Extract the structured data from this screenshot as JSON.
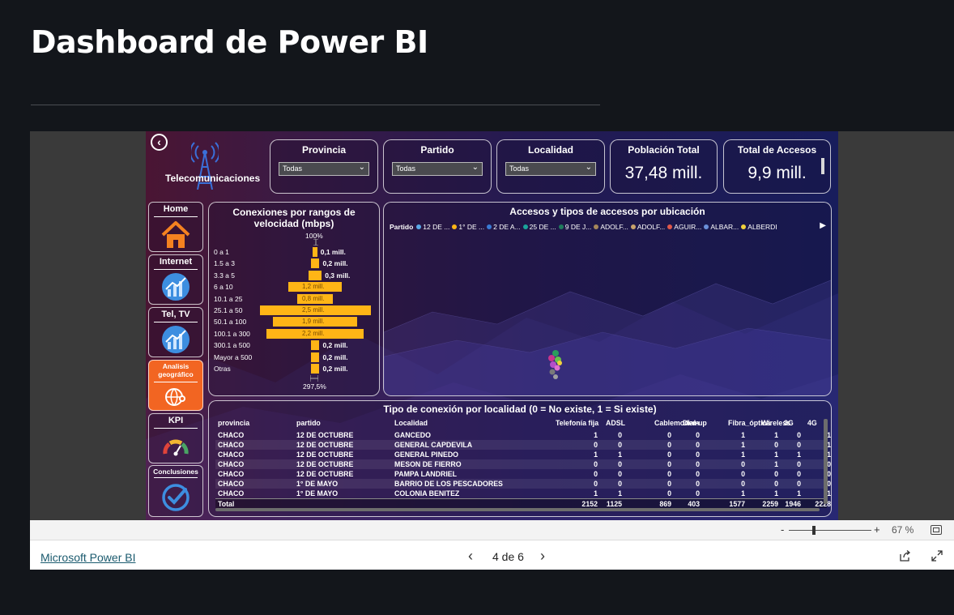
{
  "page_title": "Dashboard de Power BI",
  "report": {
    "brand": "Telecomunicaciones",
    "filters": [
      {
        "title": "Provincia",
        "value": "Todas"
      },
      {
        "title": "Partido",
        "value": "Todas"
      },
      {
        "title": "Localidad",
        "value": "Todas"
      }
    ],
    "kpis": [
      {
        "title": "Población Total",
        "value": "37,48 mill."
      },
      {
        "title": "Total de Accesos",
        "value": "9,9 mill."
      }
    ],
    "nav": [
      {
        "label": "Home"
      },
      {
        "label": "Internet"
      },
      {
        "label": "Tel, TV"
      },
      {
        "label": "Analisis geográfico"
      },
      {
        "label": "KPI"
      },
      {
        "label": "Conclusiones"
      }
    ],
    "colors": {
      "accent_bar": "#ffb516",
      "nav_active": "#f26522",
      "background": "#241a52"
    }
  },
  "chart_data": {
    "type": "bar",
    "title": "Conexiones por rangos de velocidad (mbps)",
    "top_label": "100%",
    "bottom_label": "297,5%",
    "categories": [
      "0 a 1",
      "1.5 a 3",
      "3.3 a 5",
      "6 a 10",
      "10.1 a 25",
      "25.1 a 50",
      "50.1 a 100",
      "100.1 a 300",
      "300.1 a 500",
      "Mayor a 500",
      "Otras"
    ],
    "values": [
      0.1,
      0.2,
      0.3,
      1.2,
      0.8,
      2.5,
      1.9,
      2.2,
      0.2,
      0.2,
      0.2
    ],
    "labels": [
      "0,1 mill.",
      "0,2 mill.",
      "0,3 mill.",
      "1,2 mill.",
      "0,8 mill.",
      "2,5 mill.",
      "1,9 mill.",
      "2,2 mill.",
      "0,2 mill.",
      "0,2 mill.",
      "0,2 mill."
    ],
    "orientation": "horizontal-centered"
  },
  "map": {
    "title": "Accesos y tipos de accesos por ubicación",
    "legend_title": "Partido",
    "legend": [
      {
        "label": "12 DE ...",
        "color": "#5aa9e6"
      },
      {
        "label": "1° DE ...",
        "color": "#ffb516"
      },
      {
        "label": "2 DE A...",
        "color": "#3a7bd5"
      },
      {
        "label": "25 DE ...",
        "color": "#1aa39a"
      },
      {
        "label": "9 DE J...",
        "color": "#1f7a5c"
      },
      {
        "label": "ADOLF...",
        "color": "#a5865a"
      },
      {
        "label": "ADOLF...",
        "color": "#c9a36b"
      },
      {
        "label": "AGUIR...",
        "color": "#e0584a"
      },
      {
        "label": "ALBAR...",
        "color": "#6a8fd8"
      },
      {
        "label": "ALBERDI",
        "color": "#f2d13c"
      }
    ]
  },
  "table": {
    "title": "Tipo de conexión por localidad (0 = No existe, 1 = Si existe)",
    "columns": [
      "provincia",
      "partido",
      "Localidad",
      "Telefonía fija",
      "ADSL",
      "Cablemodem",
      "Dial-up",
      "Fibra_óptica",
      "Wireless",
      "3G",
      "4G"
    ],
    "rows": [
      [
        "CHACO",
        "12 DE OCTUBRE",
        "GANCEDO",
        "1",
        "0",
        "0",
        "0",
        "1",
        "1",
        "0",
        "1"
      ],
      [
        "CHACO",
        "12 DE OCTUBRE",
        "GENERAL CAPDEVILA",
        "0",
        "0",
        "0",
        "0",
        "1",
        "0",
        "0",
        "1"
      ],
      [
        "CHACO",
        "12 DE OCTUBRE",
        "GENERAL PINEDO",
        "1",
        "1",
        "0",
        "0",
        "1",
        "1",
        "1",
        "1"
      ],
      [
        "CHACO",
        "12 DE OCTUBRE",
        "MESON DE FIERRO",
        "0",
        "0",
        "0",
        "0",
        "0",
        "1",
        "0",
        "0"
      ],
      [
        "CHACO",
        "12 DE OCTUBRE",
        "PAMPA LANDRIEL",
        "0",
        "0",
        "0",
        "0",
        "0",
        "0",
        "0",
        "0"
      ],
      [
        "CHACO",
        "1° DE MAYO",
        "BARRIO DE LOS PESCADORES",
        "0",
        "0",
        "0",
        "0",
        "0",
        "0",
        "0",
        "0"
      ],
      [
        "CHACO",
        "1° DE MAYO",
        "COLONIA BENITEZ",
        "1",
        "1",
        "0",
        "0",
        "1",
        "1",
        "1",
        "1"
      ]
    ],
    "total": [
      "Total",
      "",
      "",
      "2152",
      "1125",
      "869",
      "403",
      "1577",
      "2259",
      "1946",
      "2228"
    ]
  },
  "zoom": {
    "minus": "-",
    "plus": "+",
    "value": "67 %"
  },
  "footer": {
    "link": "Microsoft Power BI",
    "pager": "4 de 6",
    "prev": "‹",
    "next": "›"
  }
}
